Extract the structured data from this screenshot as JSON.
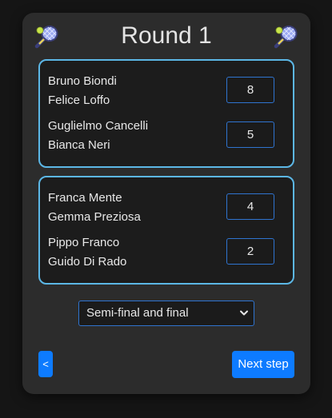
{
  "header": {
    "title": "Round 1",
    "left_icon": "tennis-racket-icon",
    "right_icon": "tennis-racket-icon"
  },
  "matches": [
    {
      "pairs": [
        {
          "player1": "Bruno Biondi",
          "player2": "Felice Loffo",
          "score": "8"
        },
        {
          "player1": "Guglielmo Cancelli",
          "player2": "Bianca Neri",
          "score": "5"
        }
      ]
    },
    {
      "pairs": [
        {
          "player1": "Franca Mente",
          "player2": "Gemma Preziosa",
          "score": "4"
        },
        {
          "player1": "Pippo Franco",
          "player2": "Guido Di Rado",
          "score": "2"
        }
      ]
    }
  ],
  "stage_select": {
    "selected": "Semi-final and final"
  },
  "nav": {
    "back_label": "<",
    "next_label": "Next step"
  },
  "colors": {
    "background": "#151515",
    "card": "#2c2c2c",
    "match_border": "#5cb7e6",
    "input_border": "#2f74d0",
    "button": "#0d7bff"
  }
}
